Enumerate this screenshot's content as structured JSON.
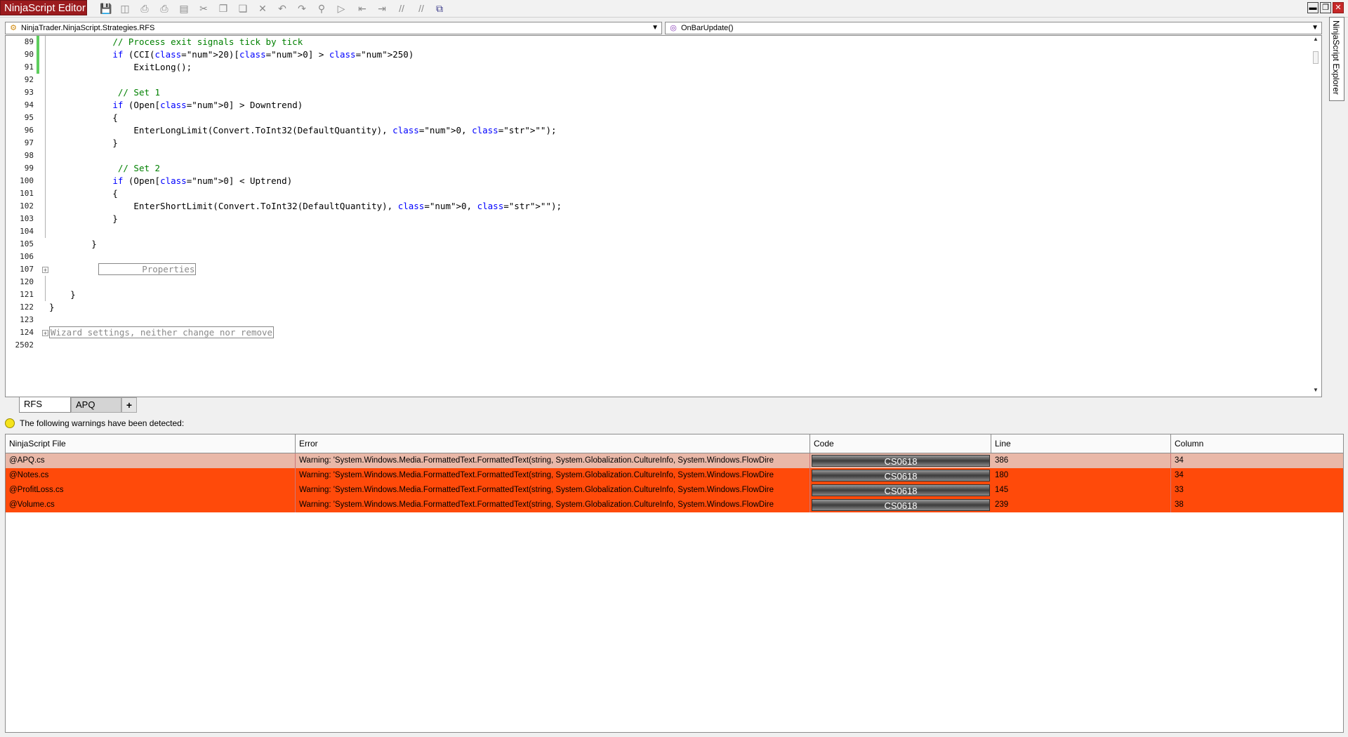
{
  "app": {
    "title": "NinjaScript Editor"
  },
  "toolbar": {
    "icons": [
      "save-icon",
      "save-all-icon",
      "print-icon",
      "print-preview-icon",
      "page-setup-icon",
      "cut-icon",
      "copy-icon",
      "paste-icon",
      "delete-icon",
      "undo-icon",
      "redo-icon",
      "find-icon",
      "compile-icon",
      "outdent-icon",
      "indent-icon",
      "comment-icon",
      "uncomment-icon",
      "visual-studio-icon"
    ]
  },
  "selectors": {
    "namespace": "NinjaTrader.NinjaScript.Strategies.RFS",
    "method": "OnBarUpdate()"
  },
  "editor": {
    "lines": [
      {
        "n": "89",
        "code": "            // Process exit signals tick by tick"
      },
      {
        "n": "90",
        "code": "            if (CCI(20)[0] > 250)"
      },
      {
        "n": "91",
        "code": "                ExitLong();"
      },
      {
        "n": "92",
        "code": ""
      },
      {
        "n": "93",
        "code": "             // Set 1"
      },
      {
        "n": "94",
        "code": "            if (Open[0] > Downtrend)"
      },
      {
        "n": "95",
        "code": "            {"
      },
      {
        "n": "96",
        "code": "                EnterLongLimit(Convert.ToInt32(DefaultQuantity), 0, \"\");"
      },
      {
        "n": "97",
        "code": "            }"
      },
      {
        "n": "98",
        "code": ""
      },
      {
        "n": "99",
        "code": "             // Set 2"
      },
      {
        "n": "100",
        "code": "            if (Open[0] < Uptrend)"
      },
      {
        "n": "101",
        "code": "            {"
      },
      {
        "n": "102",
        "code": "                EnterShortLimit(Convert.ToInt32(DefaultQuantity), 0, \"\");"
      },
      {
        "n": "103",
        "code": "            }"
      },
      {
        "n": "104",
        "code": ""
      },
      {
        "n": "105",
        "code": "        }"
      },
      {
        "n": "106",
        "code": ""
      },
      {
        "n": "107",
        "code": "        Properties"
      },
      {
        "n": "120",
        "code": ""
      },
      {
        "n": "121",
        "code": "    }"
      },
      {
        "n": "122",
        "code": "}"
      },
      {
        "n": "123",
        "code": ""
      },
      {
        "n": "124",
        "code": "Wizard settings, neither change nor remove"
      },
      {
        "n": "2502",
        "code": ""
      }
    ]
  },
  "tabs": {
    "items": [
      {
        "label": "RFS"
      },
      {
        "label": "APQ"
      }
    ],
    "add_label": "+"
  },
  "explorer": {
    "label": "NinjaScript Explorer"
  },
  "warnings": {
    "message": "The following warnings have been detected:",
    "columns": [
      "NinjaScript File",
      "Error",
      "Code",
      "Line",
      "Column"
    ],
    "rows": [
      {
        "file": "@APQ.cs",
        "error": "Warning: 'System.Windows.Media.FormattedText.FormattedText(string, System.Globalization.CultureInfo, System.Windows.FlowDire",
        "code": "CS0618",
        "line": "386",
        "column": "34"
      },
      {
        "file": "@Notes.cs",
        "error": "Warning: 'System.Windows.Media.FormattedText.FormattedText(string, System.Globalization.CultureInfo, System.Windows.FlowDire",
        "code": "CS0618",
        "line": "180",
        "column": "34"
      },
      {
        "file": "@ProfitLoss.cs",
        "error": "Warning: 'System.Windows.Media.FormattedText.FormattedText(string, System.Globalization.CultureInfo, System.Windows.FlowDire",
        "code": "CS0618",
        "line": "145",
        "column": "33"
      },
      {
        "file": "@Volume.cs",
        "error": "Warning: 'System.Windows.Media.FormattedText.FormattedText(string, System.Globalization.CultureInfo, System.Windows.FlowDire",
        "code": "CS0618",
        "line": "239",
        "column": "38"
      }
    ]
  },
  "colors": {
    "brand": "#9b1b1e",
    "error_row": "#ff4a0a",
    "selected_row": "#e9b8a8",
    "change_marker": "#5ece5e"
  }
}
